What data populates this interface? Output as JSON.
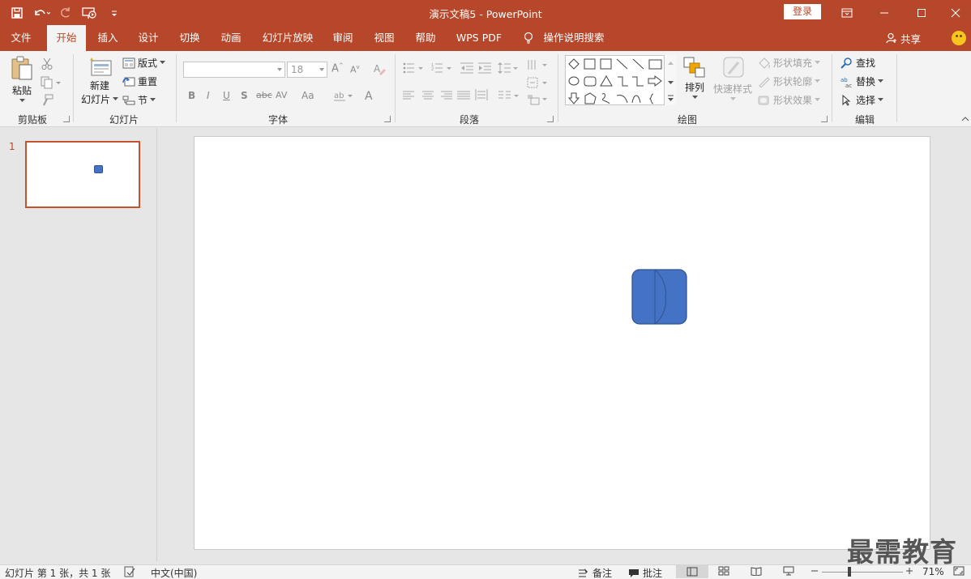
{
  "titlebar": {
    "title": "演示文稿5  -  PowerPoint",
    "login_label": "登录",
    "bg_color": "#b7472a"
  },
  "tabs": [
    {
      "label": "文件"
    },
    {
      "label": "开始",
      "active": true
    },
    {
      "label": "插入"
    },
    {
      "label": "设计"
    },
    {
      "label": "切换"
    },
    {
      "label": "动画"
    },
    {
      "label": "幻灯片放映"
    },
    {
      "label": "审阅"
    },
    {
      "label": "视图"
    },
    {
      "label": "帮助"
    },
    {
      "label": "WPS PDF"
    },
    {
      "label": "操作说明搜索"
    }
  ],
  "share_label": "共享",
  "ribbon": {
    "clipboard": {
      "label": "剪贴板",
      "paste_label": "粘贴"
    },
    "slides": {
      "label": "幻灯片",
      "new_slide_line1": "新建",
      "new_slide_line2": "幻灯片",
      "layout_label": "版式",
      "reset_label": "重置",
      "section_label": "节"
    },
    "font": {
      "label": "字体",
      "size_value": "18"
    },
    "paragraph": {
      "label": "段落"
    },
    "drawing": {
      "label": "绘图",
      "arrange_label": "排列",
      "quick_styles_label": "快速样式",
      "fill_label": "形状填充",
      "outline_label": "形状轮廓",
      "effects_label": "形状效果"
    },
    "editing": {
      "label": "编辑",
      "find_label": "查找",
      "replace_label": "替换",
      "select_label": "选择"
    }
  },
  "thumbnails": [
    {
      "number": "1"
    }
  ],
  "slide_shape": {
    "fill": "#4472c4",
    "border": "#2f528f"
  },
  "statusbar": {
    "slide_info": "幻灯片 第 1 张，共 1 张",
    "language": "中文(中国)",
    "notes_label": "备注",
    "comments_label": "批注",
    "zoom": "71%"
  },
  "watermark": "最需教育"
}
